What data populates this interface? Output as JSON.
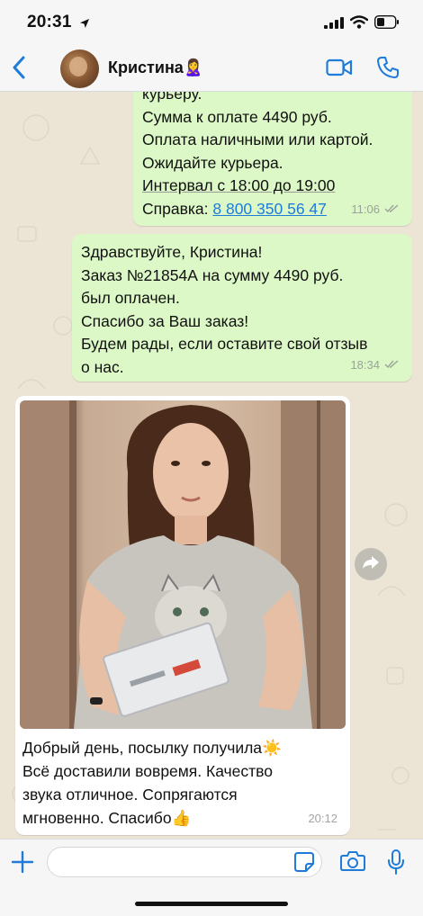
{
  "status_bar": {
    "time": "20:31"
  },
  "header": {
    "contact_name": "Кристина🙎‍♀️"
  },
  "messages": [
    {
      "direction": "outgoing",
      "lines": [
        "курьеру.",
        "Сумма к оплате 4490 руб.",
        "Оплата наличными или картой.",
        "Ожидайте курьера.",
        "Интервал с 18:00 до 19:00"
      ],
      "reference_label": "Справка: ",
      "phone": "8 800 350 56 47",
      "time": "11:06"
    },
    {
      "direction": "outgoing",
      "lines": [
        "Здравствуйте, Кристина!",
        "Заказ №21854А на сумму 4490 руб.",
        "был оплачен.",
        "Спасибо за Ваш заказ!",
        "Будем рады, если оставите свой отзыв",
        "о нас."
      ],
      "time": "18:34"
    },
    {
      "direction": "incoming",
      "has_photo": true,
      "caption_lines": [
        "Добрый день, посылку получила☀️",
        "Всё доставили вовремя. Качество",
        "звука отличное. Сопрягаются",
        "мгновенно. Спасибо👍"
      ],
      "time": "20:12"
    }
  ],
  "input": {
    "placeholder": ""
  },
  "colors": {
    "accent": "#1f7bd8",
    "outgoing_bubble": "#dcf8c6",
    "incoming_bubble": "#ffffff",
    "wallpaper": "#ece5d6"
  },
  "icons": [
    "location-arrow-icon",
    "signal-icon",
    "wifi-icon",
    "battery-icon",
    "back-chevron-icon",
    "video-call-icon",
    "phone-icon",
    "double-check-icon",
    "forward-icon",
    "plus-icon",
    "sticker-icon",
    "camera-icon",
    "microphone-icon"
  ]
}
